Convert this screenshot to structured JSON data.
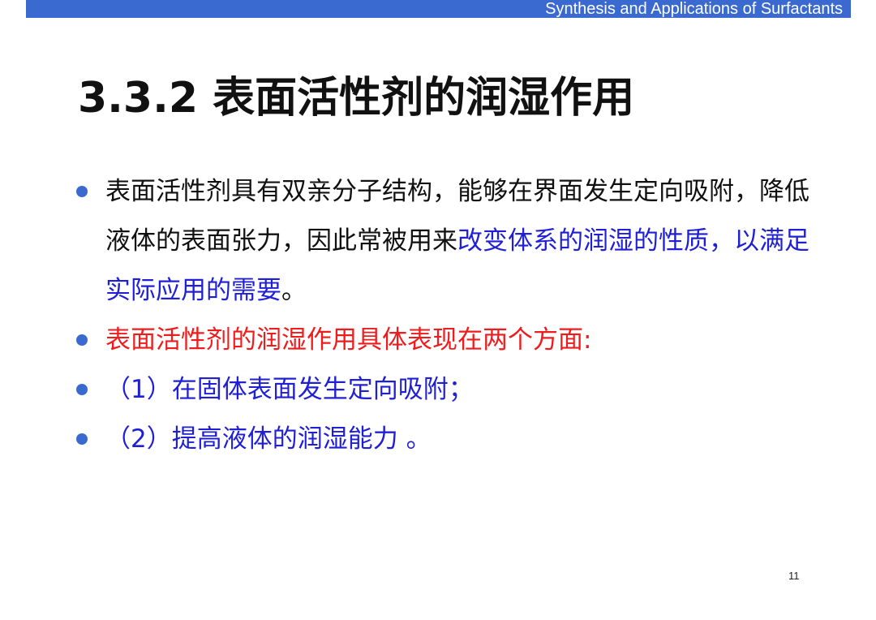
{
  "header": {
    "course_title": "Synthesis and Applications of Surfactants"
  },
  "title": "3.3.2 表面活性剂的润湿作用",
  "bullets": [
    {
      "segments": [
        "表面活性剂具有双亲分子结构，能够在界面发生定向吸附，降低液体的表面张力，因此常被用来",
        "改变体系的润湿的性质，以满足实际应用的需要",
        "。"
      ]
    },
    {
      "text": "表面活性剂的润湿作用具体表现在两个方面:"
    },
    {
      "text": " （1）在固体表面发生定向吸附；"
    },
    {
      "text": " （2）提高液体的润湿能力 。"
    }
  ],
  "page_number": "11",
  "colors": {
    "header_bar": "#3a6ad0",
    "bullet_dot": "#3a6ad0",
    "highlight_blue": "#1f1fd6",
    "highlight_red": "#ee1c1c",
    "body_text": "#111111"
  }
}
